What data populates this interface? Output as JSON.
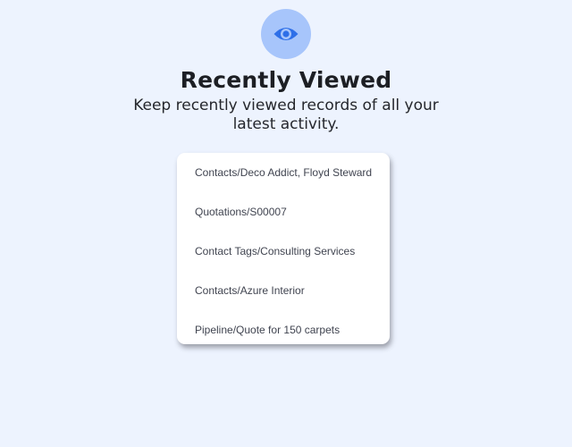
{
  "header": {
    "icon": "eye-icon",
    "title": "Recently Viewed",
    "subtitle": "Keep recently viewed records of all your latest activity."
  },
  "recent_records": [
    {
      "label": "Contacts/Deco Addict, Floyd Steward"
    },
    {
      "label": "Quotations/S00007"
    },
    {
      "label": "Contact Tags/Consulting Services"
    },
    {
      "label": "Contacts/Azure Interior"
    },
    {
      "label": "Pipeline/Quote for 150 carpets"
    }
  ],
  "colors": {
    "background": "#edf3fe",
    "icon_circle": "#a7c5fb",
    "icon": "#2e6fe8",
    "title_text": "#1d1f24",
    "record_text": "#404450",
    "card": "#ffffff"
  }
}
